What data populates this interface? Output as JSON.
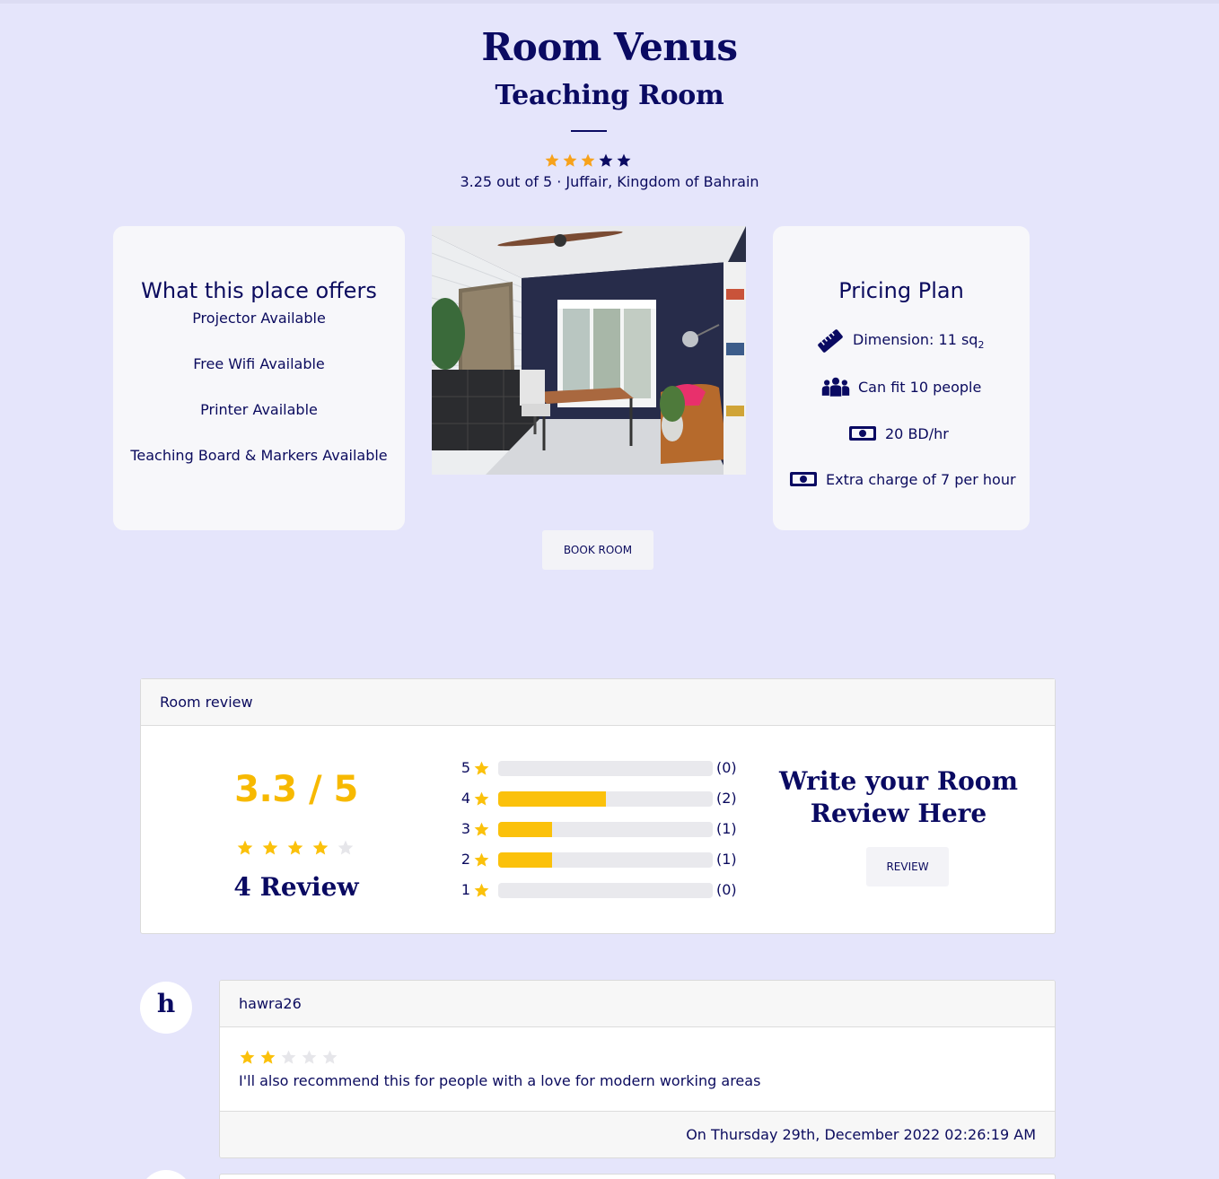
{
  "colors": {
    "page_bg": "#e5e5fb",
    "navy": "#0a0a62",
    "star_orange": "#f7a21b",
    "star_yellow": "#fbc10b",
    "star_empty": "#e6e6ea"
  },
  "room": {
    "name": "Room Venus",
    "type": "Teaching Room",
    "rating_stars": 3.25,
    "meta": "3.25 out of 5 · Juffair, Kingdom of Bahrain"
  },
  "offers": {
    "title": "What this place offers",
    "items": [
      "Projector Available",
      "Free Wifi Available",
      "Printer Available",
      "Teaching Board & Markers Available"
    ]
  },
  "pricing": {
    "title": "Pricing Plan",
    "dimension_label": "Dimension: 11 sq",
    "dimension_unit_sub": "2",
    "capacity": "Can fit 10 people",
    "rate": "20 BD/hr",
    "extra": "Extra charge of 7 per hour",
    "icons": [
      "ruler-icon",
      "people-group-icon",
      "money-bill-icon",
      "money-bill-icon"
    ]
  },
  "actions": {
    "book": "BOOK ROOM",
    "review": "REVIEW"
  },
  "review_summary": {
    "header": "Room review",
    "score": "3.3 / 5",
    "score_stars": 4,
    "count_label": "4 Review",
    "distribution": [
      {
        "stars": "5",
        "count": "(0)",
        "value": 0
      },
      {
        "stars": "4",
        "count": "(2)",
        "value": 2
      },
      {
        "stars": "3",
        "count": "(1)",
        "value": 1
      },
      {
        "stars": "2",
        "count": "(1)",
        "value": 1
      },
      {
        "stars": "1",
        "count": "(0)",
        "value": 0
      }
    ],
    "distribution_max": 4,
    "write_title": "Write your Room Review Here"
  },
  "comments": [
    {
      "initial": "h",
      "user": "hawra26",
      "stars": 2,
      "text": "I'll also recommend this for people with a love for modern working areas",
      "date": "On Thursday 29th, December 2022 02:26:19 AM"
    }
  ]
}
